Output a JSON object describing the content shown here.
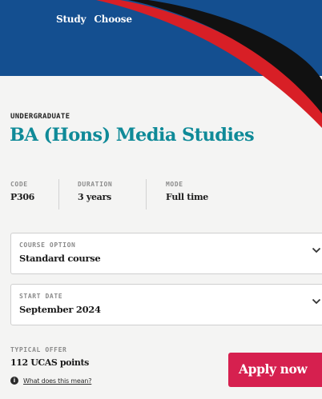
{
  "nav": {
    "items": [
      "Study",
      "Choose"
    ]
  },
  "course": {
    "level": "UNDERGRADUATE",
    "title": "BA (Hons) Media Studies",
    "meta": [
      {
        "key": "CODE",
        "value": "P306"
      },
      {
        "key": "DURATION",
        "value": "3 years"
      },
      {
        "key": "MODE",
        "value": "Full time"
      }
    ]
  },
  "course_option": {
    "label": "COURSE OPTION",
    "value": "Standard course"
  },
  "start_date": {
    "label": "START DATE",
    "value": "September 2024"
  },
  "offer": {
    "label": "TYPICAL OFFER",
    "value": "112 UCAS points",
    "help_link": "What does this mean?"
  },
  "apply_button": {
    "label": "Apply now"
  },
  "colors": {
    "header_bg": "#144f90",
    "swoosh_red": "#d81f26",
    "swoosh_black": "#111111",
    "title_teal": "#0f8a98",
    "apply_pink": "#d6204f"
  },
  "icons": [
    "chevron-down-icon",
    "info-icon"
  ]
}
